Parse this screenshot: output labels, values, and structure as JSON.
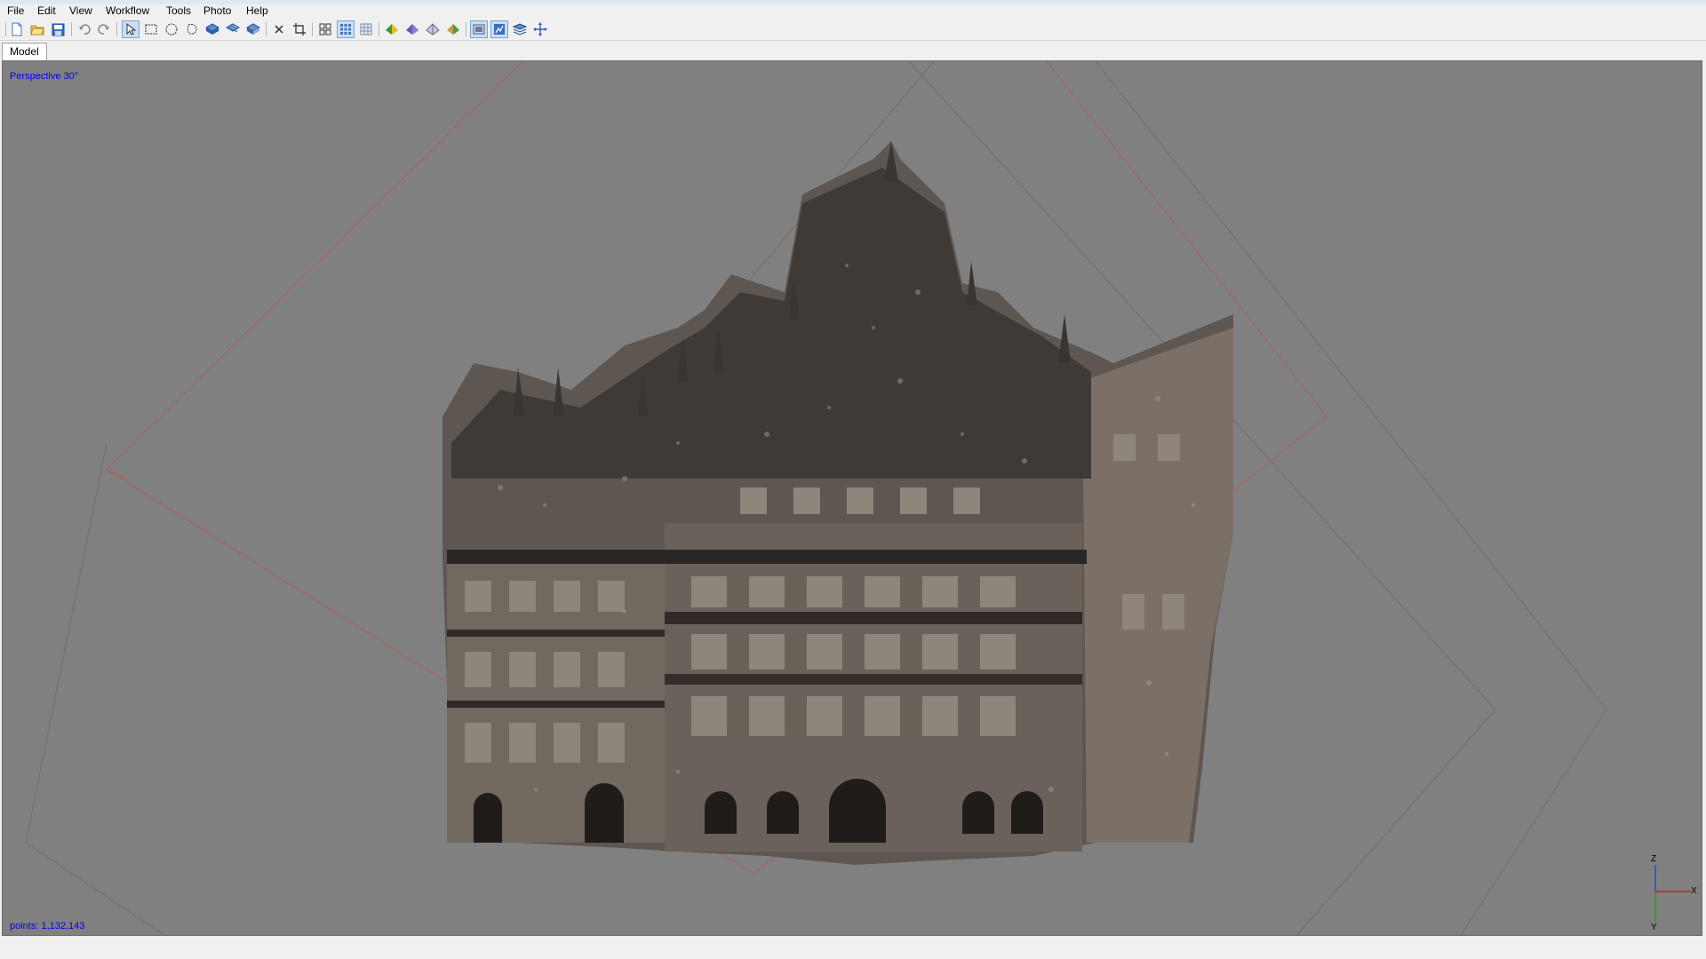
{
  "menu": {
    "items": [
      {
        "label": "File"
      },
      {
        "label": "Edit"
      },
      {
        "label": "View"
      },
      {
        "label": "Workflow"
      },
      {
        "label": "Tools"
      },
      {
        "label": "Photo"
      },
      {
        "label": "Help"
      }
    ]
  },
  "toolbar": {
    "buttons": [
      {
        "icon": "new-document-icon"
      },
      {
        "icon": "open-folder-icon"
      },
      {
        "icon": "save-icon"
      },
      {
        "icon": "undo-icon"
      },
      {
        "icon": "redo-icon"
      },
      {
        "icon": "navigation-cursor-icon",
        "active": true
      },
      {
        "icon": "rectangle-selection-icon"
      },
      {
        "icon": "circle-selection-icon"
      },
      {
        "icon": "free-form-selection-icon"
      },
      {
        "icon": "shape-tool-1-icon"
      },
      {
        "icon": "shape-tool-2-icon"
      },
      {
        "icon": "shape-tool-3-icon"
      },
      {
        "icon": "delete-selection-icon"
      },
      {
        "icon": "crop-selection-icon"
      },
      {
        "icon": "grid-icon"
      },
      {
        "icon": "show-cameras-icon",
        "active": true
      },
      {
        "icon": "show-points-icon"
      },
      {
        "icon": "solid-model-icon"
      },
      {
        "icon": "wireframe-model-icon"
      },
      {
        "icon": "shaded-model-icon"
      },
      {
        "icon": "textured-model-icon"
      },
      {
        "icon": "show-region-icon",
        "active": true
      },
      {
        "icon": "show-point-cloud-icon",
        "active": true
      },
      {
        "icon": "show-layers-icon"
      },
      {
        "icon": "navigation-move-icon"
      }
    ]
  },
  "tabs": [
    {
      "label": "Model"
    }
  ],
  "viewport": {
    "projection_label": "Perspective 30°",
    "points_label": "points: 1,132,143",
    "axis_labels": {
      "z": "Z",
      "x": "X",
      "y": "Y"
    },
    "background_color": "#808080",
    "label_color": "#0000ee",
    "region_box_color": "#b05a5a"
  }
}
